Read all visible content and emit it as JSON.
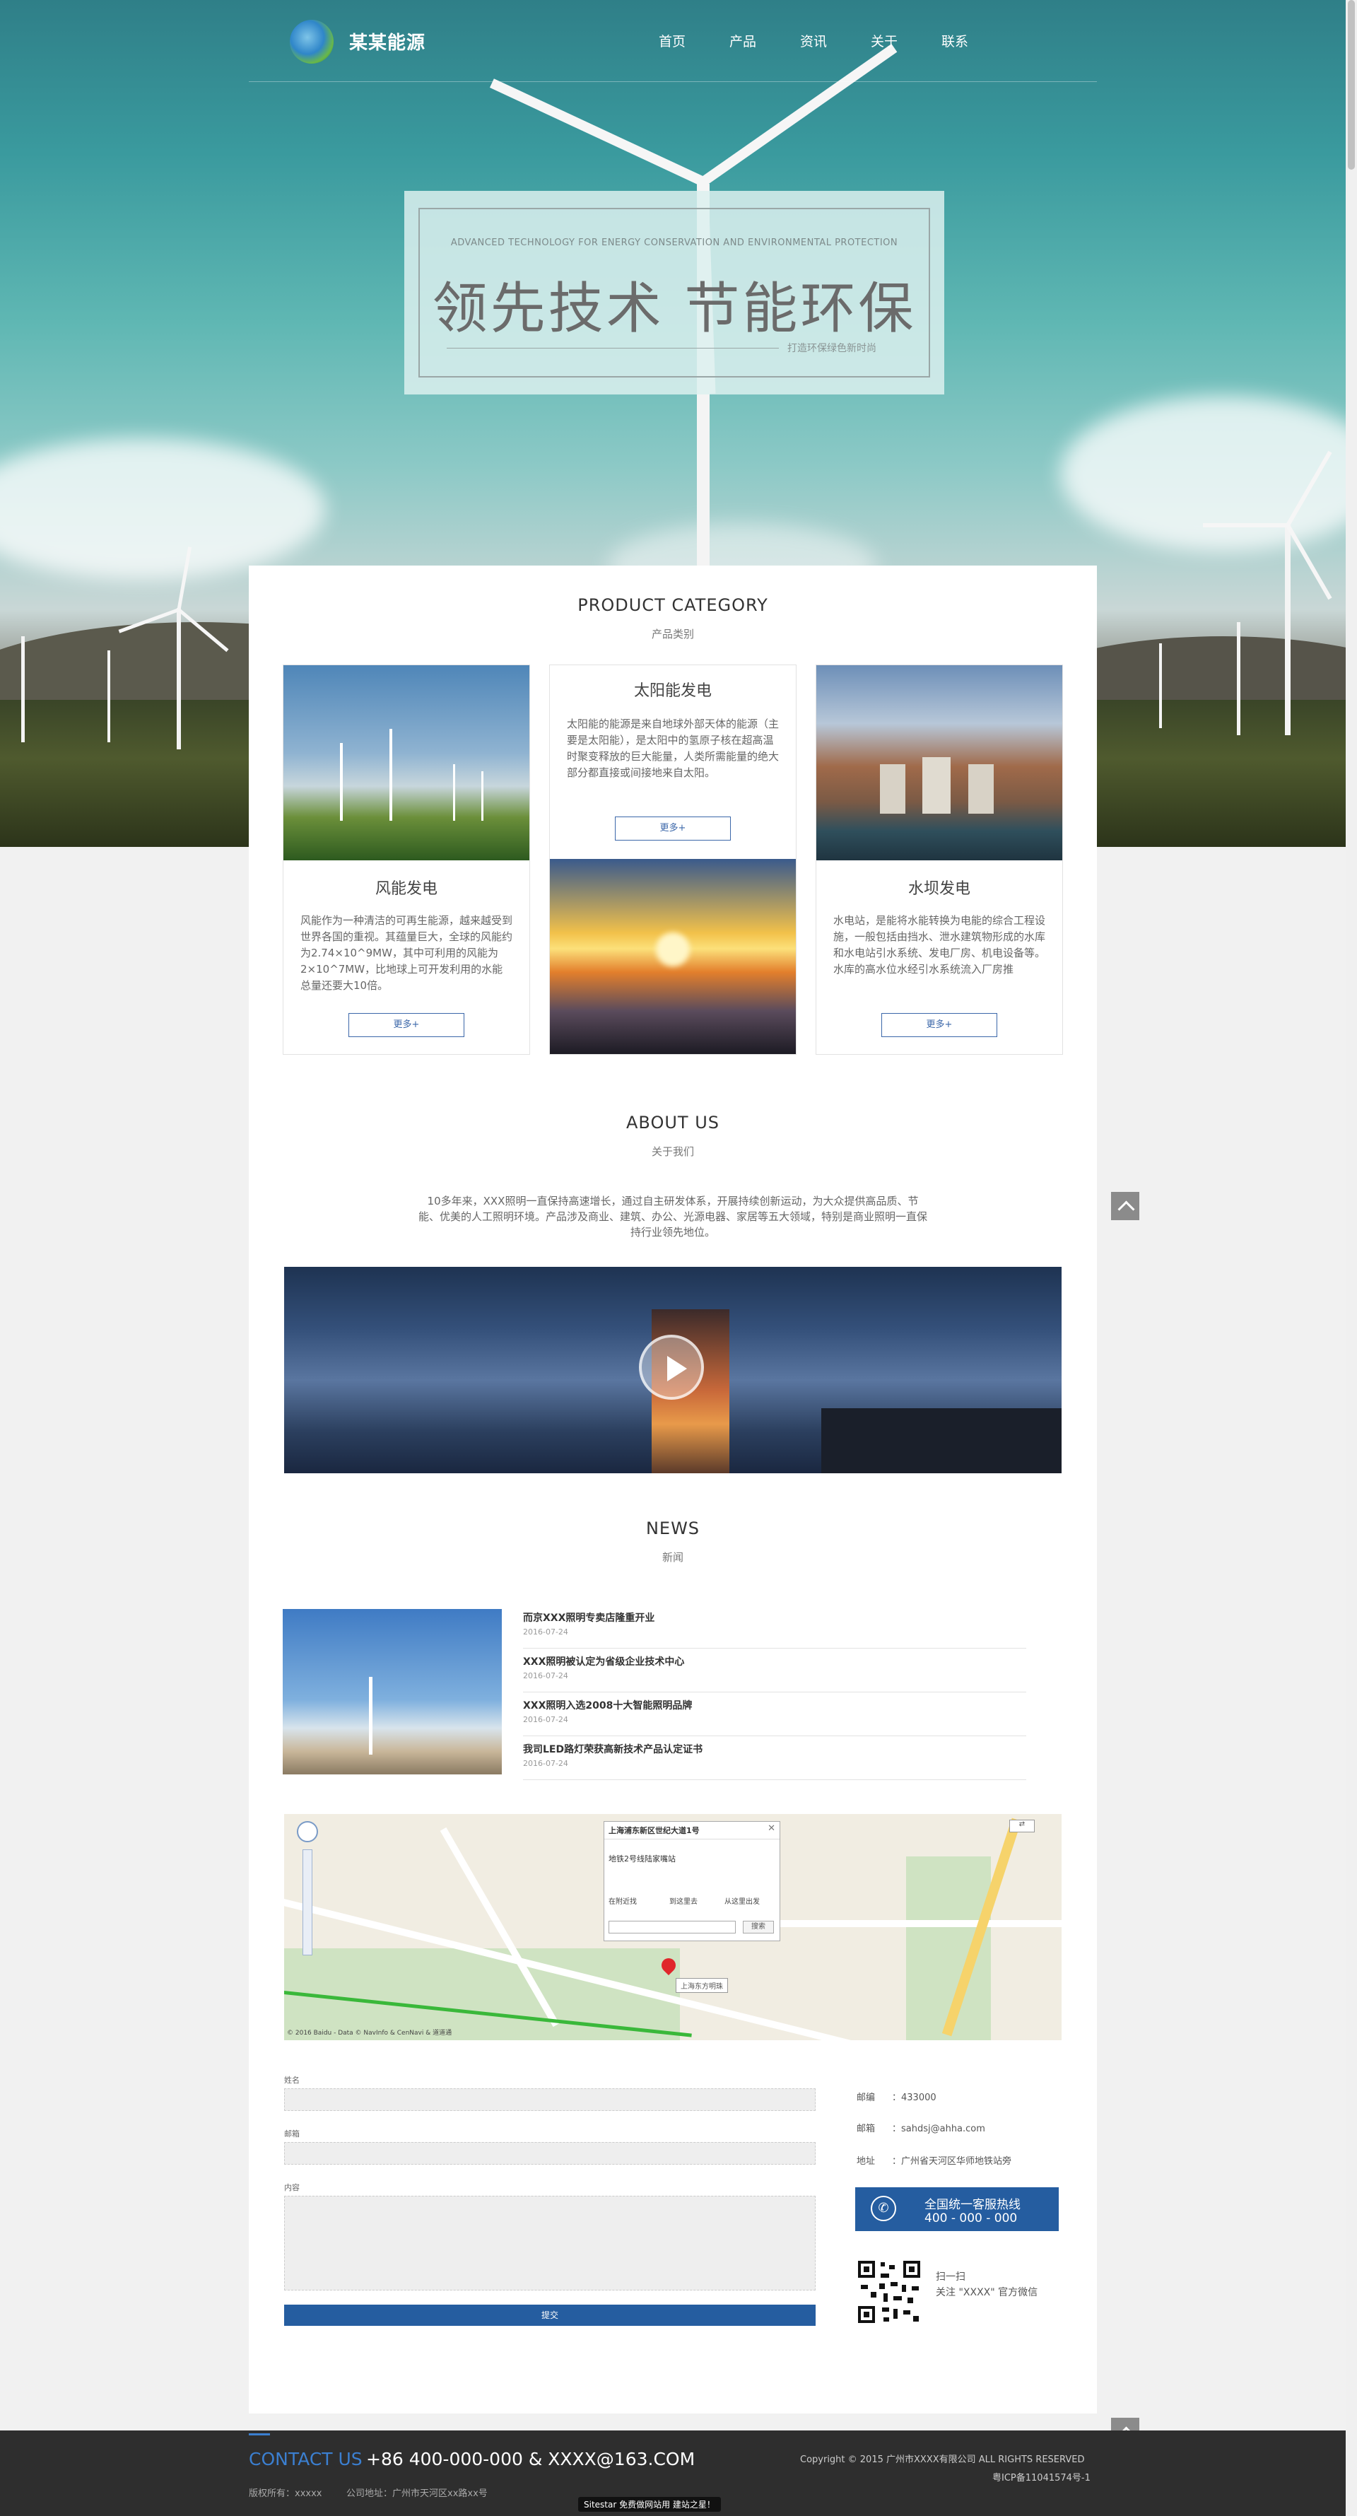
{
  "brand": {
    "name": "某某能源"
  },
  "nav": {
    "items": [
      "首页",
      "产品",
      "资讯",
      "关于",
      "联系"
    ]
  },
  "banner": {
    "en": "ADVANCED TECHNOLOGY FOR ENERGY CONSERVATION AND ENVIRONMENTAL PROTECTION",
    "cn": "领先技术  节能环保",
    "sub": "打造环保绿色新时尚"
  },
  "products": {
    "title": "PRODUCT CATEGORY",
    "subtitle": "产品类别",
    "items": [
      {
        "title": "风能发电",
        "text": "风能作为一种清洁的可再生能源，越来越受到世界各国的重视。其蕴量巨大，全球的风能约为2.74×10^9MW，其中可利用的风能为2×10^7MW，比地球上可开发利用的水能总量还要大10倍。",
        "more": "更多+"
      },
      {
        "title": "太阳能发电",
        "text": "太阳能的能源是来自地球外部天体的能源（主要是太阳能），是太阳中的氢原子核在超高温时聚变释放的巨大能量，人类所需能量的绝大部分都直接或间接地来自太阳。",
        "more": "更多+"
      },
      {
        "title": "水坝发电",
        "text": "水电站，是能将水能转换为电能的综合工程设施，一般包括由挡水、泄水建筑物形成的水库和水电站引水系统、发电厂房、机电设备等。水库的高水位水经引水系统流入厂房推",
        "more": "更多+"
      }
    ]
  },
  "about": {
    "title": "ABOUT US",
    "subtitle": "关于我们",
    "text": "10多年来，XXX照明一直保持高速增长，通过自主研发体系，开展持续创新运动，为大众提供高品质、节能、优美的人工照明环境。产品涉及商业、建筑、办公、光源电器、家居等五大领域，特别是商业照明一直保持行业领先地位。"
  },
  "news": {
    "title": "NEWS",
    "subtitle": "新闻",
    "items": [
      {
        "title": "而京XXX照明专卖店隆重开业",
        "date": "2016-07-24"
      },
      {
        "title": "XXX照明被认定为省级企业技术中心",
        "date": "2016-07-24"
      },
      {
        "title": "XXX照明入选2008十大智能照明品牌",
        "date": "2016-07-24"
      },
      {
        "title": "我司LED路灯荣获高新技术产品认定证书",
        "date": "2016-07-24"
      }
    ]
  },
  "map": {
    "popup_title": "上海浦东新区世纪大道1号",
    "popup_desc": "地铁2号线陆家嘴站",
    "actions": [
      "在附近找",
      "到这里去",
      "从这里出发"
    ],
    "search_btn": "搜索",
    "marker_label": "上海东方明珠",
    "copyright": "© 2016 Baidu - Data © NavInfo & CenNavi & 道道通"
  },
  "form": {
    "name_label": "姓名",
    "email_label": "邮箱",
    "content_label": "内容",
    "submit": "提交"
  },
  "contact": {
    "rows": [
      {
        "label": "邮编",
        "value": "：433000"
      },
      {
        "label": "邮箱",
        "value": "：sahdsj@ahha.com"
      },
      {
        "label": "地址",
        "value": "：广州省天河区华师地铁站旁"
      }
    ],
    "hotline_title": "全国统一客服热线",
    "hotline_number": "400 - 000 - 000",
    "qr_line1": "扫一扫",
    "qr_line2": "关注 \"XXXX\" 官方微信"
  },
  "footer": {
    "contact_label": "CONTACT US",
    "contact_value": "+86 400-000-000 & XXXX@163.COM",
    "copyright": "Copyright © 2015 广州市XXXX有限公司 ALL RIGHTS RESERVED",
    "icp": "粤ICP备11041574号-1",
    "owner": "版权所有：xxxxx",
    "address": "公司地址：广州市天河区xx路xx号",
    "badge": "Sitestar 免费做网站用 建站之星！"
  }
}
